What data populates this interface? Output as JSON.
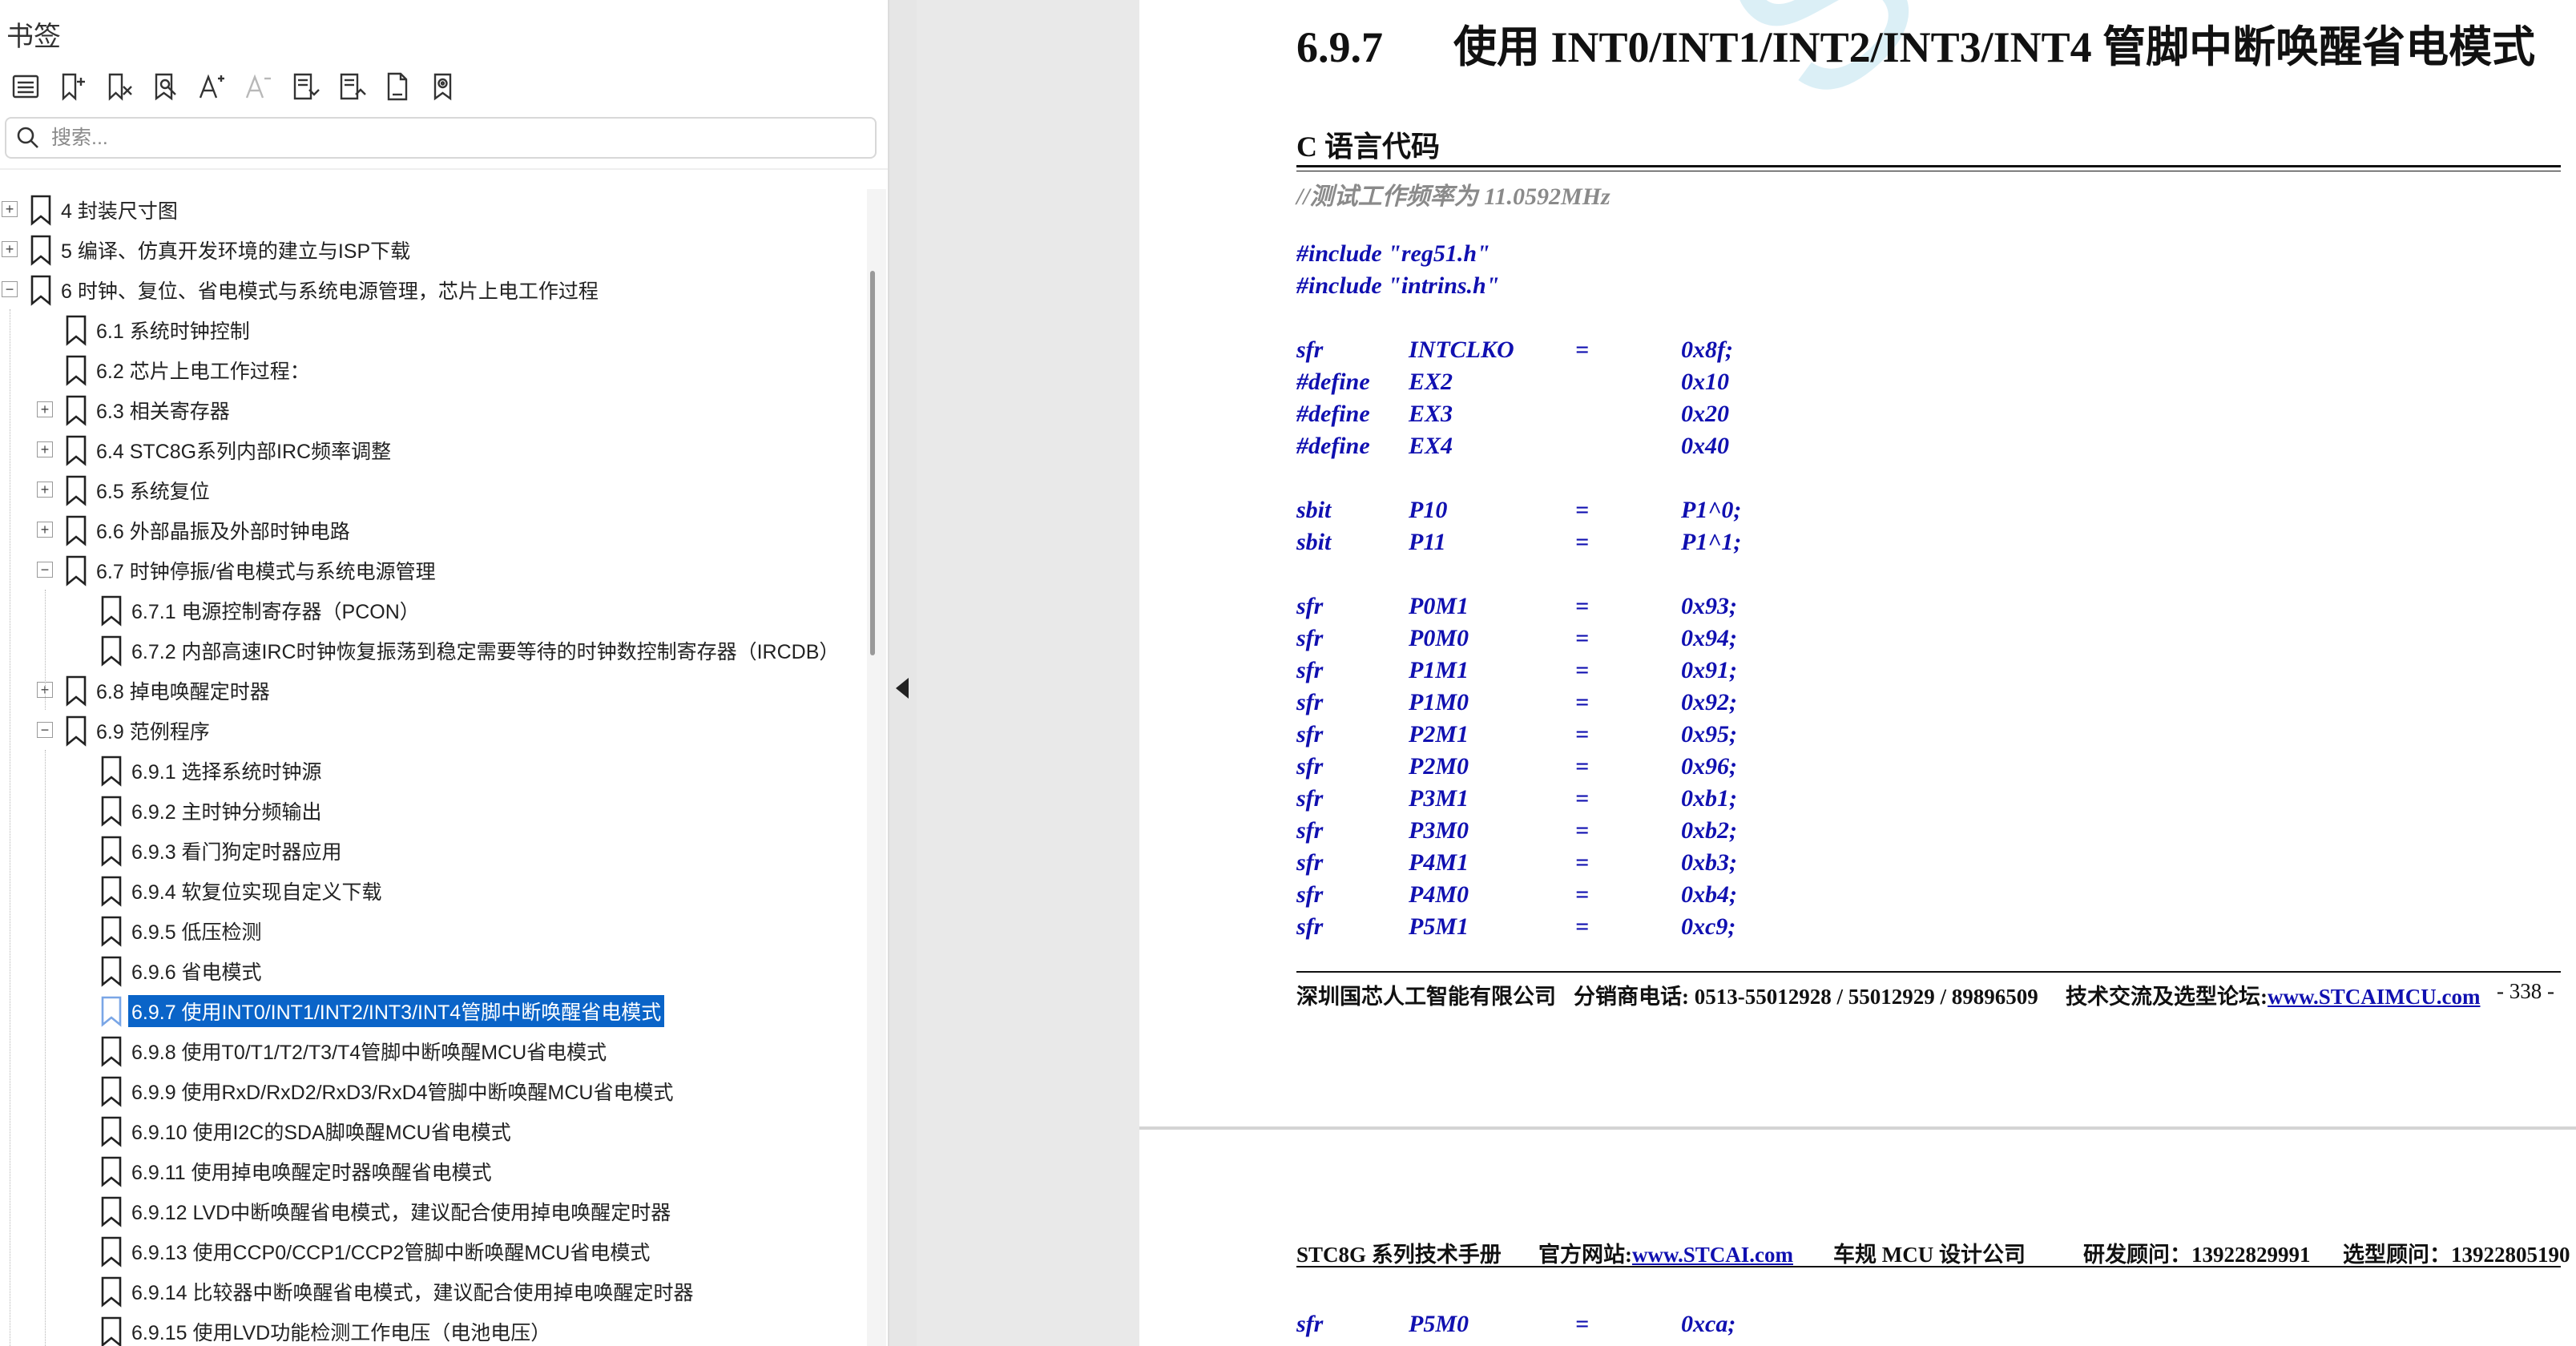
{
  "sidebar": {
    "title": "书签",
    "toolbar": [
      {
        "name": "outline-list-icon",
        "enabled": true
      },
      {
        "name": "add-bookmark-icon",
        "enabled": true
      },
      {
        "name": "delete-bookmark-icon",
        "enabled": true
      },
      {
        "name": "find-bookmark-icon",
        "enabled": true
      },
      {
        "name": "font-increase-icon",
        "enabled": true
      },
      {
        "name": "font-decrease-icon",
        "enabled": false
      },
      {
        "name": "expand-all-icon",
        "enabled": true
      },
      {
        "name": "collapse-all-icon",
        "enabled": true
      },
      {
        "name": "page-export-icon",
        "enabled": true
      },
      {
        "name": "bookmark-settings-icon",
        "enabled": true
      }
    ],
    "search": {
      "placeholder": "搜索...",
      "value": ""
    },
    "tree": [
      {
        "label": "4  封装尺寸图",
        "level": 0,
        "expander": "+"
      },
      {
        "label": "5  编译、仿真开发环境的建立与ISP下载",
        "level": 0,
        "expander": "+"
      },
      {
        "label": "6  时钟、复位、省电模式与系统电源管理，芯片上电工作过程",
        "level": 0,
        "expander": "-"
      },
      {
        "label": "6.1 系统时钟控制",
        "level": 1,
        "expander": ""
      },
      {
        "label": "6.2  芯片上电工作过程：",
        "level": 1,
        "expander": ""
      },
      {
        "label": "6.3  相关寄存器",
        "level": 1,
        "expander": "+"
      },
      {
        "label": "6.4  STC8G系列内部IRC频率调整",
        "level": 1,
        "expander": "+"
      },
      {
        "label": "6.5  系统复位",
        "level": 1,
        "expander": "+"
      },
      {
        "label": "6.6  外部晶振及外部时钟电路",
        "level": 1,
        "expander": "+"
      },
      {
        "label": "6.7  时钟停振/省电模式与系统电源管理",
        "level": 1,
        "expander": "-"
      },
      {
        "label": "6.7.1 电源控制寄存器（PCON）",
        "level": 2,
        "expander": ""
      },
      {
        "label": "6.7.2  内部高速IRC时钟恢复振荡到稳定需要等待的时钟数控制寄存器（IRCDB）",
        "level": 2,
        "expander": ""
      },
      {
        "label": "6.8  掉电唤醒定时器",
        "level": 1,
        "expander": "+"
      },
      {
        "label": "6.9  范例程序",
        "level": 1,
        "expander": "-"
      },
      {
        "label": "6.9.1 选择系统时钟源",
        "level": 2,
        "expander": ""
      },
      {
        "label": "6.9.2 主时钟分频输出",
        "level": 2,
        "expander": ""
      },
      {
        "label": "6.9.3 看门狗定时器应用",
        "level": 2,
        "expander": ""
      },
      {
        "label": "6.9.4 软复位实现自定义下载",
        "level": 2,
        "expander": ""
      },
      {
        "label": "6.9.5 低压检测",
        "level": 2,
        "expander": ""
      },
      {
        "label": "6.9.6 省电模式",
        "level": 2,
        "expander": ""
      },
      {
        "label": "6.9.7 使用INT0/INT1/INT2/INT3/INT4管脚中断唤醒省电模式",
        "level": 2,
        "expander": "",
        "selected": true
      },
      {
        "label": "6.9.8 使用T0/T1/T2/T3/T4管脚中断唤醒MCU省电模式",
        "level": 2,
        "expander": ""
      },
      {
        "label": "6.9.9 使用RxD/RxD2/RxD3/RxD4管脚中断唤醒MCU省电模式",
        "level": 2,
        "expander": ""
      },
      {
        "label": "6.9.10 使用I2C的SDA脚唤醒MCU省电模式",
        "level": 2,
        "expander": ""
      },
      {
        "label": "6.9.11 使用掉电唤醒定时器唤醒省电模式",
        "level": 2,
        "expander": ""
      },
      {
        "label": "6.9.12 LVD中断唤醒省电模式，建议配合使用掉电唤醒定时器",
        "level": 2,
        "expander": ""
      },
      {
        "label": "6.9.13 使用CCP0/CCP1/CCP2管脚中断唤醒MCU省电模式",
        "level": 2,
        "expander": ""
      },
      {
        "label": "6.9.14 比较器中断唤醒省电模式，建议配合使用掉电唤醒定时器",
        "level": 2,
        "expander": ""
      },
      {
        "label": "6.9.15 使用LVD功能检测工作电压（电池电压）",
        "level": 2,
        "expander": ""
      }
    ]
  },
  "document": {
    "watermark": "STC",
    "page1": {
      "section_number": "6.9.7",
      "section_title": "使用 INT0/INT1/INT2/INT3/INT4 管脚中断唤醒省电模式",
      "code_heading": "C 语言代码",
      "comment": "//测试工作频率为 11.0592MHz",
      "includes": [
        "#include \"reg51.h\"",
        "#include \"intrins.h\""
      ],
      "declarations": [
        {
          "group": 0,
          "kw": "sfr",
          "name": "INTCLKO",
          "eq": "=",
          "val": "0x8f;"
        },
        {
          "group": 0,
          "kw": "#define",
          "name": "EX2",
          "eq": "",
          "val": "0x10"
        },
        {
          "group": 0,
          "kw": "#define",
          "name": "EX3",
          "eq": "",
          "val": "0x20"
        },
        {
          "group": 0,
          "kw": "#define",
          "name": "EX4",
          "eq": "",
          "val": "0x40"
        },
        {
          "group": 1,
          "kw": "sbit",
          "name": "P10",
          "eq": "=",
          "val": "P1^0;"
        },
        {
          "group": 1,
          "kw": "sbit",
          "name": "P11",
          "eq": "=",
          "val": "P1^1;"
        },
        {
          "group": 2,
          "kw": "sfr",
          "name": "P0M1",
          "eq": "=",
          "val": "0x93;"
        },
        {
          "group": 2,
          "kw": "sfr",
          "name": "P0M0",
          "eq": "=",
          "val": "0x94;"
        },
        {
          "group": 2,
          "kw": "sfr",
          "name": "P1M1",
          "eq": "=",
          "val": "0x91;"
        },
        {
          "group": 2,
          "kw": "sfr",
          "name": "P1M0",
          "eq": "=",
          "val": "0x92;"
        },
        {
          "group": 2,
          "kw": "sfr",
          "name": "P2M1",
          "eq": "=",
          "val": "0x95;"
        },
        {
          "group": 2,
          "kw": "sfr",
          "name": "P2M0",
          "eq": "=",
          "val": "0x96;"
        },
        {
          "group": 2,
          "kw": "sfr",
          "name": "P3M1",
          "eq": "=",
          "val": "0xb1;"
        },
        {
          "group": 2,
          "kw": "sfr",
          "name": "P3M0",
          "eq": "=",
          "val": "0xb2;"
        },
        {
          "group": 2,
          "kw": "sfr",
          "name": "P4M1",
          "eq": "=",
          "val": "0xb3;"
        },
        {
          "group": 2,
          "kw": "sfr",
          "name": "P4M0",
          "eq": "=",
          "val": "0xb4;"
        },
        {
          "group": 2,
          "kw": "sfr",
          "name": "P5M1",
          "eq": "=",
          "val": "0xc9;"
        }
      ],
      "footer": {
        "company": "深圳国芯人工智能有限公司",
        "phones": "分销商电话: 0513-55012928 / 55012929 / 89896509",
        "forum_label": "技术交流及选型论坛:",
        "forum_link": "www.STCAIMCU.com",
        "page": "- 338 -"
      }
    },
    "page2": {
      "header": {
        "manual": "STC8G 系列技术手册",
        "site_label": "官方网站:",
        "site_link": "www.STCAI.com",
        "design": "车规 MCU 设计公司",
        "advisor": "研发顾问：13922829991",
        "selection": "选型顾问：13922805190"
      },
      "declarations": [
        {
          "kw": "sfr",
          "name": "P5M0",
          "eq": "=",
          "val": "0xca;"
        }
      ]
    }
  }
}
